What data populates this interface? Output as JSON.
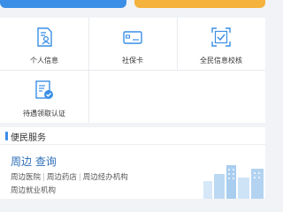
{
  "grid": {
    "items": [
      {
        "label": "个人信息",
        "icon": "person-id-icon"
      },
      {
        "label": "社保卡",
        "icon": "card-icon"
      },
      {
        "label": "全民信息校核",
        "icon": "verify-check-icon"
      },
      {
        "label": "待遇领取认证",
        "icon": "certification-icon"
      }
    ]
  },
  "services": {
    "title": "便民服务",
    "nearby": {
      "title_part1": "周边",
      "title_part2": "查询",
      "links": [
        "周边医院",
        "周边药店",
        "周边经办机构"
      ],
      "links_row2": [
        "周边就业机构"
      ]
    }
  },
  "colors": {
    "accent": "#3a8ee6",
    "orange": "#f5b23c"
  }
}
